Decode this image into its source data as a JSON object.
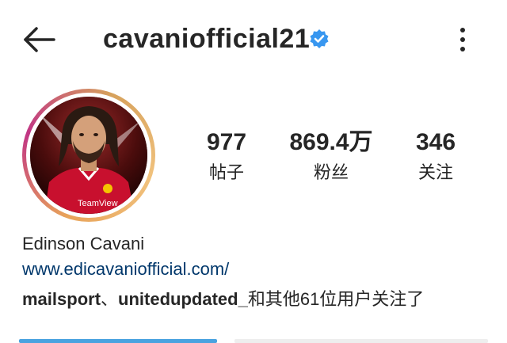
{
  "header": {
    "username": "cavaniofficial21",
    "back_icon": "arrow-left-icon",
    "more_icon": "more-vertical-icon",
    "verified_icon": "verified-badge-icon",
    "verified_color": "#3897f0"
  },
  "profile": {
    "avatar": "profile-photo",
    "avatar_caption": "TeamView",
    "stats": {
      "posts_count": "977",
      "posts_label": "帖子",
      "followers_count": "869.4万",
      "followers_label": "粉丝",
      "following_count": "346",
      "following_label": "关注"
    },
    "full_name": "Edinson Cavani",
    "website": "www.edicavaniofficial.com/",
    "followed_by": {
      "user1": "mailsport",
      "separator": "、",
      "user2": "unitedupdated_",
      "suffix": "和其他61位用户关注了"
    }
  },
  "colors": {
    "text": "#262626",
    "link": "#00376b",
    "accent": "#4aa3e0"
  }
}
